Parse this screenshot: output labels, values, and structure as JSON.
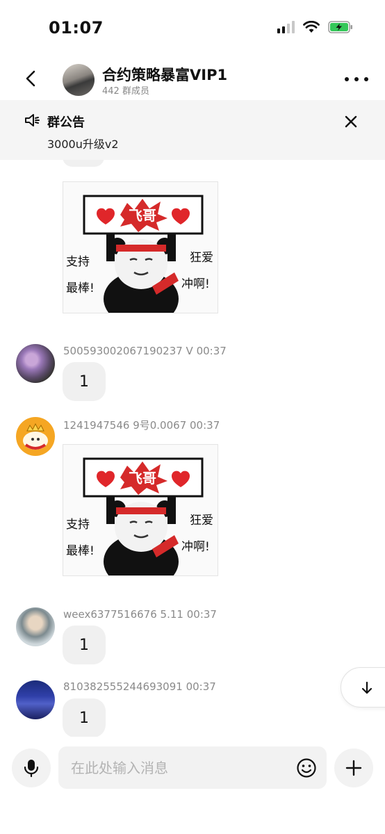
{
  "status_bar": {
    "time": "01:07",
    "battery_color": "#34c759"
  },
  "header": {
    "title": "合约策略暴富VIP1",
    "subtitle": "442 群成员"
  },
  "notice": {
    "title": "群公告",
    "text": "3000u升级v2"
  },
  "meme": {
    "top_label": "飞哥",
    "left_text": [
      "支持",
      "最棒!"
    ],
    "right_text": [
      "狂爱",
      "冲啊!"
    ]
  },
  "messages": [
    {
      "sender": "500593002067190237 V",
      "time": "00:37",
      "text": "1"
    },
    {
      "sender": "1241947546 9号0.0067",
      "time": "00:37"
    },
    {
      "sender": "weex6377516676 5.11",
      "time": "00:37",
      "text": "1"
    },
    {
      "sender": "810382555244693091",
      "time": "00:37",
      "text": "1"
    }
  ],
  "input": {
    "placeholder": "在此处输入消息"
  }
}
